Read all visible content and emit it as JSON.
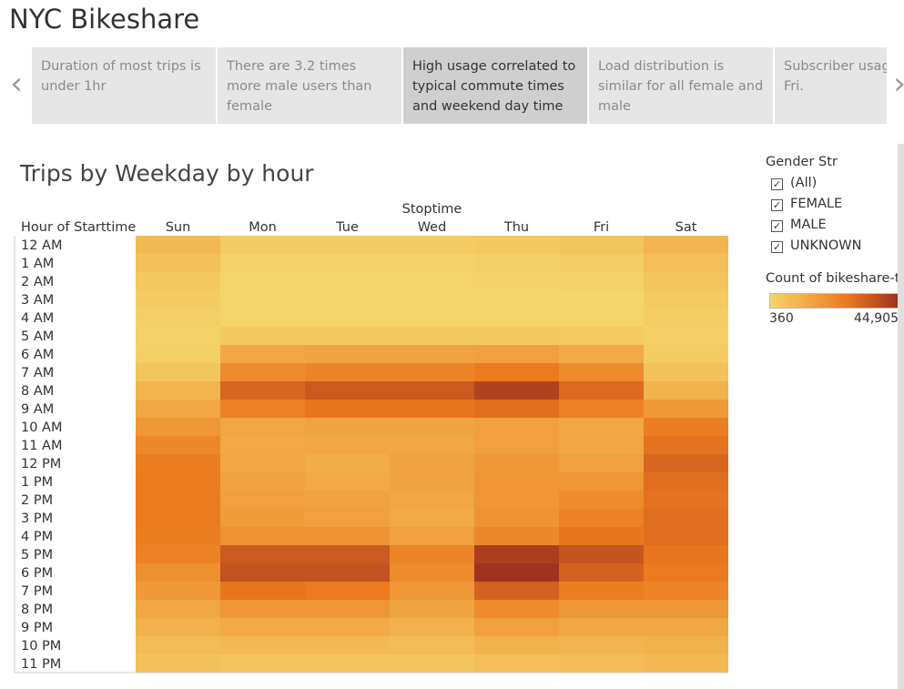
{
  "app": {
    "title": "NYC Bikeshare"
  },
  "story": {
    "prev_icon": "chevron-left-icon",
    "next_icon": "chevron-right-icon",
    "points": [
      {
        "text": "Duration of most trips is under 1hr",
        "active": false
      },
      {
        "text": "There are 3.2 times more male users than female",
        "active": false
      },
      {
        "text": "High usage correlated to typical commute times and weekend day time",
        "active": true
      },
      {
        "text": "Load distribution is similar for all female and male",
        "active": false
      },
      {
        "text": "Subscriber usage Mon-Fri.",
        "active": false
      }
    ]
  },
  "sheet": {
    "title": "Trips by Weekday by hour"
  },
  "filters": {
    "title": "Gender Str",
    "items": [
      {
        "label": "(All)",
        "checked": true
      },
      {
        "label": "FEMALE",
        "checked": true
      },
      {
        "label": "MALE",
        "checked": true
      },
      {
        "label": "UNKNOWN",
        "checked": true
      }
    ]
  },
  "color_legend": {
    "title": "Count of bikeshare-t",
    "min_label": "360",
    "max_label": "44,905",
    "low_color": "#f5d56a",
    "mid_color": "#ec7a1f",
    "high_color": "#a0321f"
  },
  "chart_data": {
    "type": "heatmap",
    "title": "Trips by Weekday by hour",
    "column_header": "Stoptime",
    "row_header": "Hour of Starttime",
    "columns": [
      "Sun",
      "Mon",
      "Tue",
      "Wed",
      "Thu",
      "Fri",
      "Sat"
    ],
    "rows": [
      "12 AM",
      "1 AM",
      "2 AM",
      "3 AM",
      "4 AM",
      "5 AM",
      "6 AM",
      "7 AM",
      "8 AM",
      "9 AM",
      "10 AM",
      "11 AM",
      "12 PM",
      "1 PM",
      "2 PM",
      "3 PM",
      "4 PM",
      "5 PM",
      "6 PM",
      "7 PM",
      "8 PM",
      "9 PM",
      "10 PM",
      "11 PM"
    ],
    "value_range": [
      360,
      44905
    ],
    "values": [
      [
        9000,
        3000,
        3000,
        3000,
        4000,
        5000,
        10000
      ],
      [
        6000,
        1500,
        1500,
        1500,
        2000,
        2500,
        7000
      ],
      [
        4000,
        800,
        800,
        800,
        900,
        1200,
        5000
      ],
      [
        3000,
        500,
        500,
        500,
        600,
        700,
        3500
      ],
      [
        2000,
        360,
        400,
        400,
        400,
        500,
        2500
      ],
      [
        1500,
        4000,
        4000,
        4000,
        4000,
        3500,
        1800
      ],
      [
        2000,
        14000,
        15000,
        15000,
        16000,
        13000,
        3000
      ],
      [
        5000,
        22000,
        24000,
        24000,
        27000,
        22000,
        6000
      ],
      [
        10000,
        32000,
        35000,
        35000,
        41000,
        31000,
        11000
      ],
      [
        14000,
        25000,
        28000,
        28000,
        30000,
        25000,
        18000
      ],
      [
        19000,
        14000,
        15000,
        15000,
        16000,
        14000,
        26000
      ],
      [
        23000,
        13000,
        14000,
        14000,
        16000,
        14000,
        29000
      ],
      [
        26000,
        14000,
        12000,
        15000,
        18000,
        16000,
        32000
      ],
      [
        27000,
        15000,
        13000,
        15000,
        19000,
        19000,
        30000
      ],
      [
        27000,
        16000,
        15000,
        14000,
        19000,
        22000,
        29000
      ],
      [
        27000,
        17000,
        16000,
        13000,
        20000,
        25000,
        30000
      ],
      [
        26000,
        20000,
        20000,
        16000,
        23000,
        28000,
        30000
      ],
      [
        25000,
        35000,
        35000,
        24000,
        42000,
        36000,
        28000
      ],
      [
        21000,
        37000,
        37000,
        22000,
        44905,
        33000,
        27000
      ],
      [
        18000,
        28000,
        27000,
        19000,
        33000,
        26000,
        24000
      ],
      [
        14000,
        19000,
        19000,
        15000,
        22000,
        19000,
        19000
      ],
      [
        11000,
        13000,
        13000,
        11000,
        16000,
        14000,
        14000
      ],
      [
        8000,
        9000,
        9000,
        8000,
        11000,
        10000,
        11000
      ],
      [
        6000,
        5000,
        5000,
        5000,
        7000,
        8000,
        9000
      ]
    ]
  }
}
